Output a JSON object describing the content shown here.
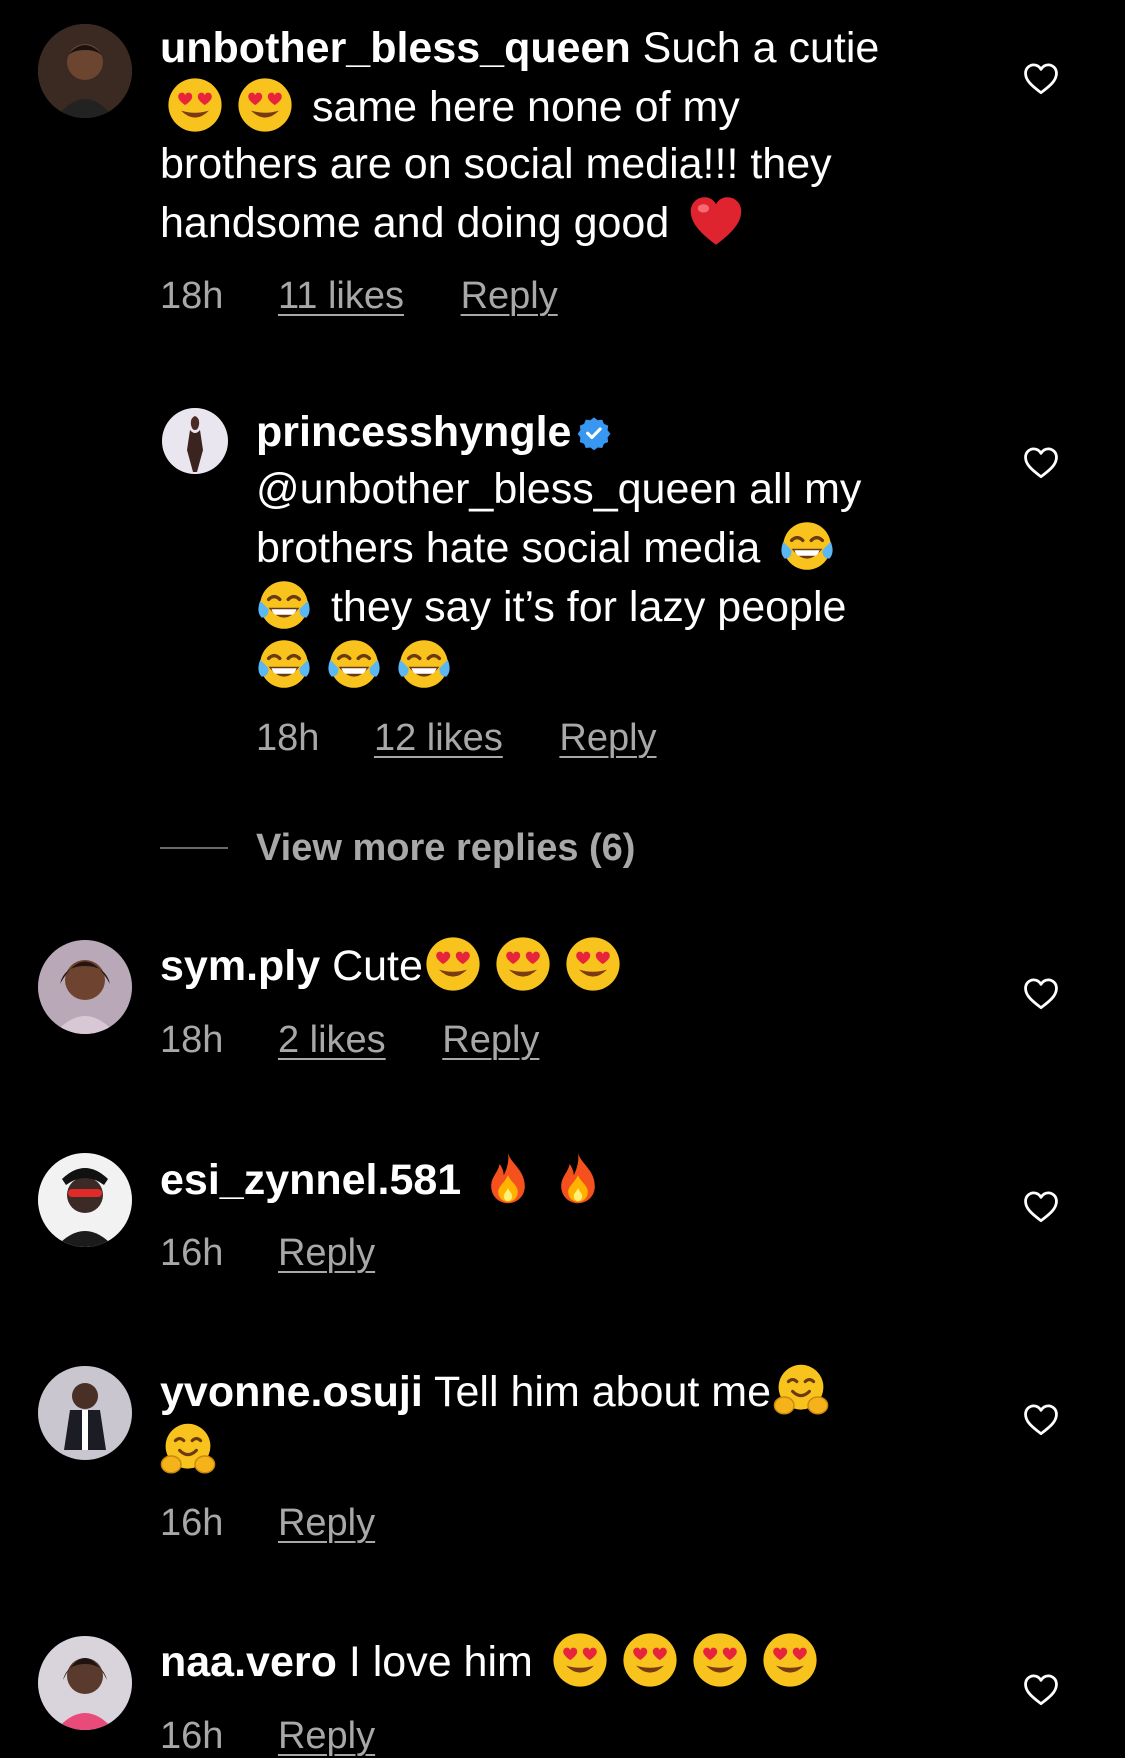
{
  "comments": [
    {
      "username": "unbother_bless_queen",
      "text_1": "Such a cutie",
      "text_2": "same here none of my",
      "text_3": "brothers are on social media!!! they",
      "text_4": "handsome and doing good",
      "time": "18h",
      "likes": "11 likes",
      "reply": "Reply"
    },
    {
      "username": "princesshyngle",
      "verified": true,
      "text_1": "@unbother_bless_queen all my",
      "text_2": "brothers hate social media",
      "text_3": "they say it’s for lazy people",
      "time": "18h",
      "likes": "12 likes",
      "reply": "Reply"
    },
    {
      "username": "sym.ply",
      "text_1": "Cute",
      "time": "18h",
      "likes": "2 likes",
      "reply": "Reply"
    },
    {
      "username": "esi_zynnel.581",
      "text_1": "",
      "time": "16h",
      "reply": "Reply"
    },
    {
      "username": "yvonne.osuji",
      "text_1": "Tell him about me",
      "time": "16h",
      "reply": "Reply"
    },
    {
      "username": "naa.vero",
      "text_1": "I love him",
      "time": "16h",
      "reply": "Reply"
    }
  ],
  "view_more": "View more replies (6)",
  "icons": {
    "heart": "heart-outline-icon",
    "verified": "verified-badge-icon",
    "heart_eyes": "heart-eyes-emoji",
    "red_heart": "red-heart-emoji",
    "joy": "tears-of-joy-emoji",
    "fire": "fire-emoji",
    "hug": "hugging-face-emoji"
  },
  "colors": {
    "background": "#000000",
    "text": "#ffffff",
    "meta": "#a8a8a8",
    "verified": "#3897f0"
  }
}
